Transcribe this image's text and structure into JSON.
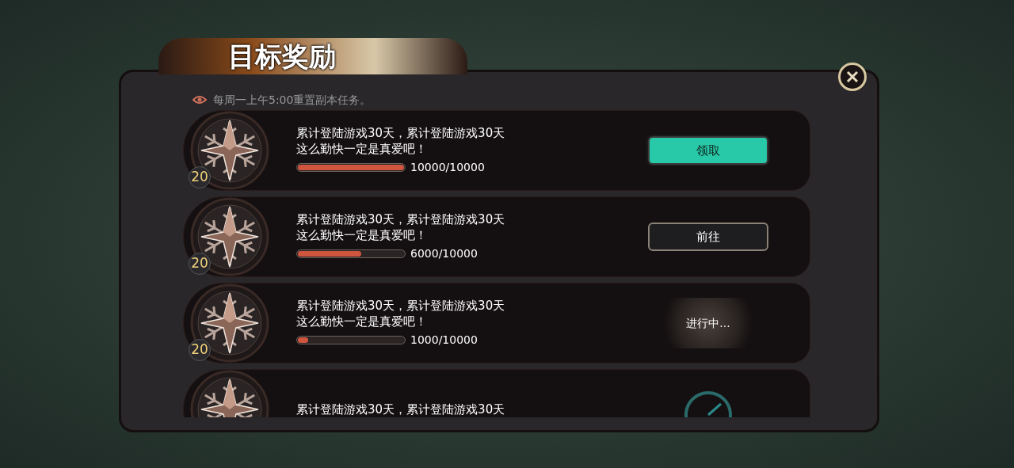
{
  "title": "目标奖励",
  "notice": "每周一上午5:00重置副本任务。",
  "rows": [
    {
      "badge": "20",
      "lines": [
        "累计登陆游戏30天，累计登陆游戏30天",
        "这么勤快一定是真爱吧！"
      ],
      "level": 1,
      "reading": "10000/10000",
      "action": {
        "kind": "claim",
        "label": "领取"
      }
    },
    {
      "badge": "20",
      "lines": [
        "累计登陆游戏30天，累计登陆游戏30天",
        "这么勤快一定是真爱吧！"
      ],
      "level": 0.6,
      "reading": "6000/10000",
      "action": {
        "kind": "goto",
        "label": "前往"
      }
    },
    {
      "badge": "20",
      "lines": [
        "累计登陆游戏30天，累计登陆游戏30天",
        "这么勤快一定是真爱吧！"
      ],
      "level": 0.1,
      "reading": "1000/10000",
      "action": {
        "kind": "progress",
        "label": "进行中..."
      }
    },
    {
      "lines": [
        "累计登陆游戏30天，累计登陆游戏30天"
      ],
      "action": {
        "kind": "dial"
      }
    }
  ]
}
